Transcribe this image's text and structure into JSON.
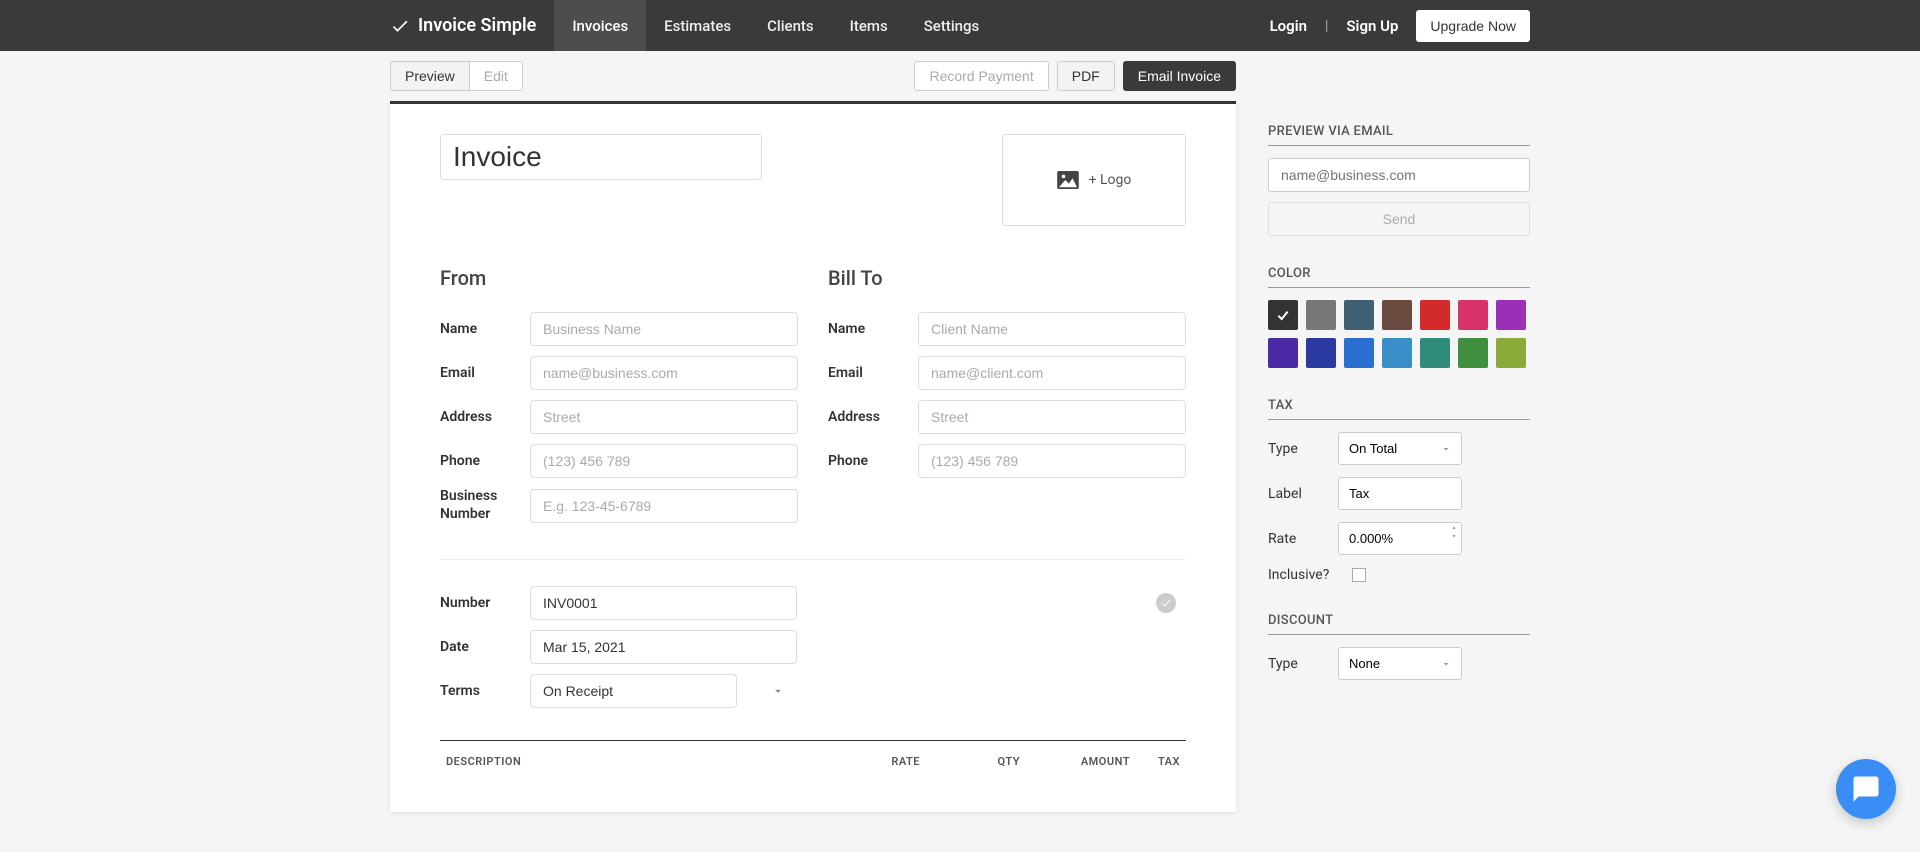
{
  "nav": {
    "brand": "Invoice Simple",
    "links": [
      "Invoices",
      "Estimates",
      "Clients",
      "Items",
      "Settings"
    ],
    "active_index": 0,
    "login": "Login",
    "signup": "Sign Up",
    "upgrade": "Upgrade Now"
  },
  "toolbar": {
    "preview": "Preview",
    "edit": "Edit",
    "record_payment": "Record Payment",
    "pdf": "PDF",
    "email_invoice": "Email Invoice"
  },
  "invoice": {
    "title": "Invoice",
    "logo_label": "+ Logo",
    "from": {
      "heading": "From",
      "name_label": "Name",
      "name_ph": "Business Name",
      "email_label": "Email",
      "email_ph": "name@business.com",
      "address_label": "Address",
      "address_ph": "Street",
      "phone_label": "Phone",
      "phone_ph": "(123) 456 789",
      "biznum_label": "Business Number",
      "biznum_ph": "E.g. 123-45-6789"
    },
    "to": {
      "heading": "Bill To",
      "name_label": "Name",
      "name_ph": "Client Name",
      "email_label": "Email",
      "email_ph": "name@client.com",
      "address_label": "Address",
      "address_ph": "Street",
      "phone_label": "Phone",
      "phone_ph": "(123) 456 789"
    },
    "meta": {
      "number_label": "Number",
      "number_value": "INV0001",
      "date_label": "Date",
      "date_value": "Mar 15, 2021",
      "terms_label": "Terms",
      "terms_value": "On Receipt"
    },
    "items_header": {
      "description": "DESCRIPTION",
      "rate": "RATE",
      "qty": "QTY",
      "amount": "AMOUNT",
      "tax": "TAX"
    }
  },
  "sidebar": {
    "preview_email": {
      "heading": "PREVIEW VIA EMAIL",
      "placeholder": "name@business.com",
      "send": "Send"
    },
    "color": {
      "heading": "COLOR",
      "swatches": [
        "#333333",
        "#777777",
        "#3f6072",
        "#6b4a3f",
        "#d32b2b",
        "#d8326b",
        "#9b2fb5",
        "#4b2aa5",
        "#2a3aa0",
        "#2a6ecf",
        "#3a8ec7",
        "#2f8b7a",
        "#3f8f3f",
        "#8aaa3a"
      ],
      "selected_index": 0
    },
    "tax": {
      "heading": "TAX",
      "type_label": "Type",
      "type_value": "On Total",
      "label_label": "Label",
      "label_value": "Tax",
      "rate_label": "Rate",
      "rate_value": "0.000%",
      "inclusive_label": "Inclusive?"
    },
    "discount": {
      "heading": "DISCOUNT",
      "type_label": "Type",
      "type_value": "None"
    }
  }
}
